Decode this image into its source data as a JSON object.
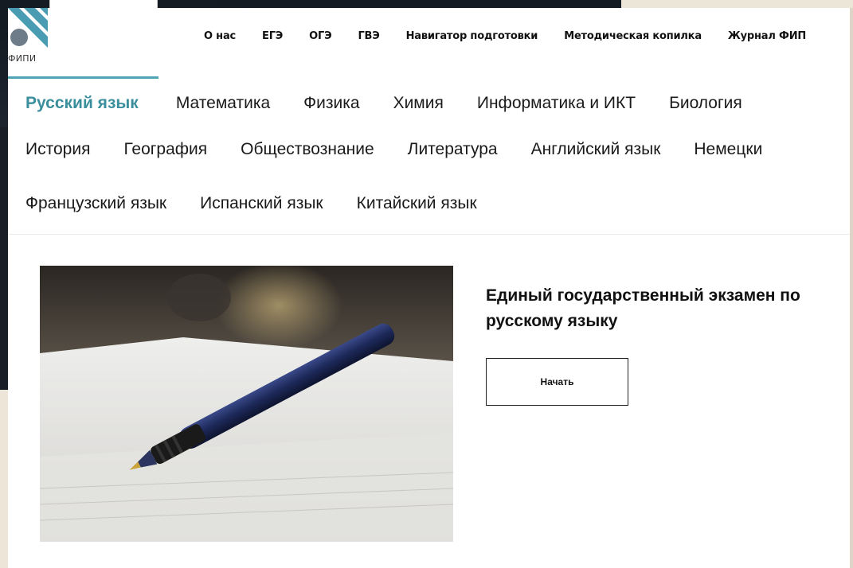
{
  "logo": {
    "text": "ФИПИ",
    "icon": "fipi-logo-icon"
  },
  "topnav": [
    "О нас",
    "ЕГЭ",
    "ОГЭ",
    "ГВЭ",
    "Навигатор подготовки",
    "Методическая копилка",
    "Журнал ФИП"
  ],
  "subjects": {
    "row1": [
      "Русский язык",
      "Математика",
      "Физика",
      "Химия",
      "Информатика и ИКТ",
      "Биология"
    ],
    "row2": [
      "История",
      "География",
      "Обществознание",
      "Литература",
      "Английский язык",
      "Немецки"
    ],
    "row3": [
      "Французский язык",
      "Испанский язык",
      "Китайский язык"
    ],
    "active": "Русский язык"
  },
  "hero": {
    "title": "Единый государственный экзамен по русскому языку",
    "button_label": "Начать",
    "image": "pen-on-paper-photo"
  },
  "colors": {
    "accent": "#3b8f9d",
    "accent_border": "#4ea3b4",
    "logo_blue": "#4a9cb3"
  }
}
